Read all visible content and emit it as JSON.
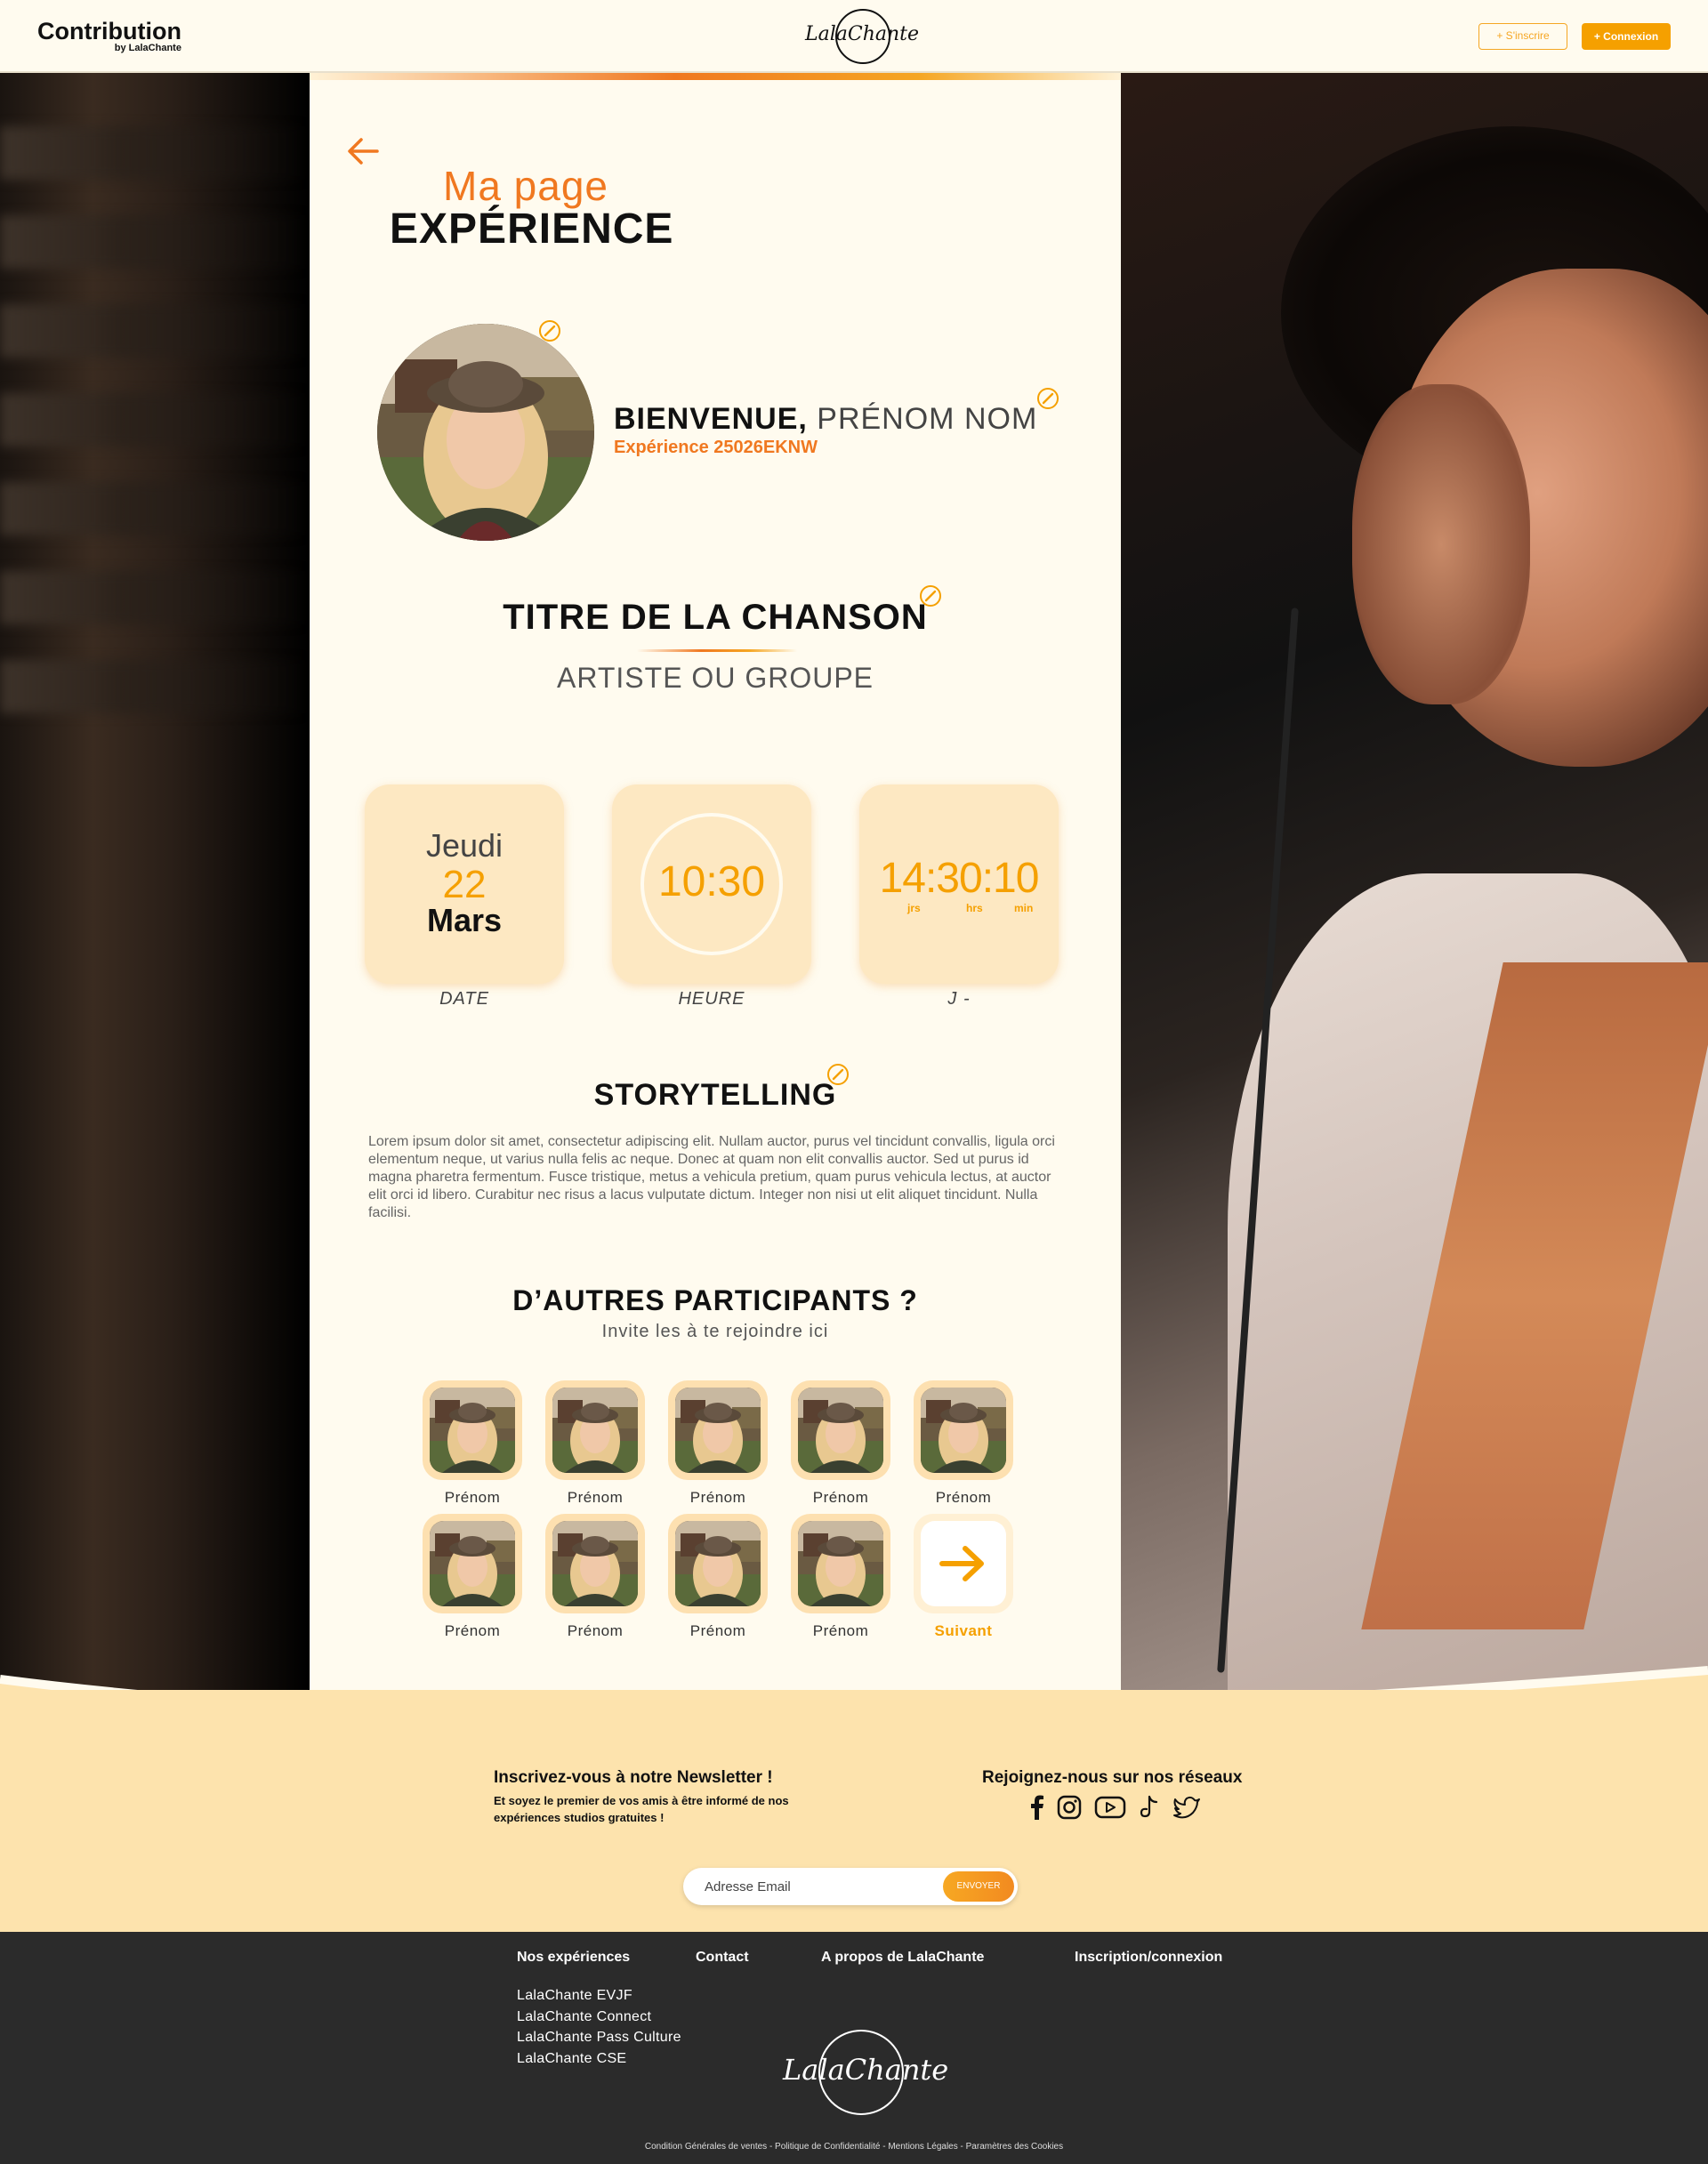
{
  "header": {
    "brand_title": "Contribution",
    "brand_sub": "by LalaChante",
    "logo_text": "LalaChante",
    "signup_label": "+ S'inscrire",
    "login_label": "+ Connexion"
  },
  "colors": {
    "accent": "#f5a000",
    "orange": "#f07820",
    "cream": "#fffbef",
    "peach": "#fde8c2",
    "footer": "#2b2b2b"
  },
  "page": {
    "title_light": "Ma page",
    "title_bold": "EXPÉRIENCE",
    "welcome_bold": "BIENVENUE,",
    "welcome_name": " PRÉNOM NOM",
    "experience_code": "Expérience 25026EKNW",
    "song_title": "TITRE DE LA CHANSON",
    "artist": "ARTISTE OU GROUPE"
  },
  "cards": {
    "date": {
      "day": "Jeudi",
      "num": "22",
      "month": "Mars",
      "label": "DATE"
    },
    "time": {
      "value": "10:30",
      "label": "HEURE"
    },
    "countdown": {
      "value": "14:30:10",
      "units": [
        "jrs",
        "hrs",
        "min"
      ],
      "label": "J -"
    }
  },
  "story": {
    "title": "STORYTELLING",
    "text": "Lorem ipsum dolor sit amet, consectetur adipiscing elit. Nullam auctor, purus vel tincidunt convallis, ligula orci elementum neque, ut varius nulla felis ac neque. Donec at quam non elit convallis auctor. Sed ut purus id magna pharetra fermentum. Fusce tristique, metus a vehicula pretium, quam purus vehicula lectus, at auctor elit orci id libero. Curabitur nec risus a lacus vulputate dictum. Integer non nisi ut elit aliquet tincidunt. Nulla facilisi."
  },
  "participants": {
    "title": "D’AUTRES PARTICIPANTS ?",
    "subtitle": "Invite les à te rejoindre ici",
    "names": [
      "Prénom",
      "Prénom",
      "Prénom",
      "Prénom",
      "Prénom",
      "Prénom",
      "Prénom",
      "Prénom",
      "Prénom"
    ],
    "next_label": "Suivant"
  },
  "newsletter": {
    "title": "Inscrivez-vous à notre Newsletter !",
    "subtitle": "Et soyez le premier de vos amis à être informé de nos expériences studios gratuites !",
    "email_placeholder": "Adresse Email",
    "send_label": "ENVOYER"
  },
  "social": {
    "title": "Rejoignez-nous sur nos réseaux",
    "icons": [
      "facebook-icon",
      "instagram-icon",
      "youtube-icon",
      "tiktok-icon",
      "twitter-icon"
    ]
  },
  "footer": {
    "headings": [
      "Nos expériences",
      "Contact",
      "A propos de LalaChante",
      "Inscription/connexion"
    ],
    "links": [
      "LalaChante EVJF",
      "LalaChante Connect",
      "LalaChante Pass Culture",
      "LalaChante CSE"
    ],
    "logo_text": "LalaChante",
    "legal": "Condition Générales de ventes - Politique de Confidentialité - Mentions Légales - Paramètres des Cookies"
  }
}
